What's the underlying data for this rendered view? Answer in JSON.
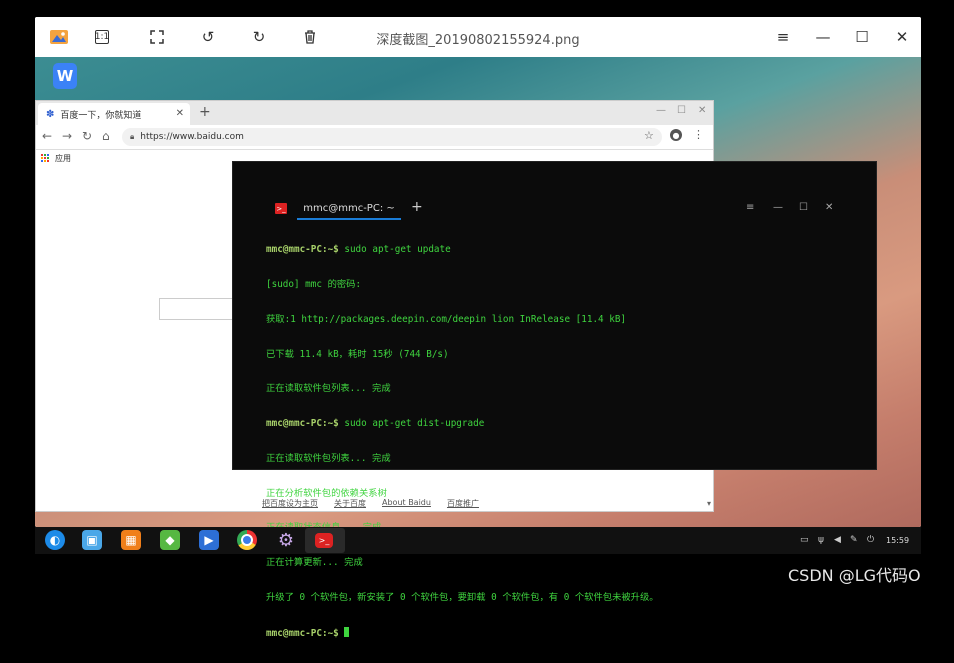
{
  "viewer": {
    "title": "深度截图_20190802155924.png",
    "toolbar": {
      "fit_label": "1:1"
    }
  },
  "browser": {
    "tab_title": "百度一下，你就知道",
    "url": "https://www.baidu.com",
    "bookmark_apps": "应用",
    "footer_links": [
      "把百度设为主页",
      "关于百度",
      "About Baidu",
      "百度推广"
    ]
  },
  "terminal": {
    "tab_title": "mmc@mmc-PC: ~",
    "lines": [
      {
        "prompt": "mmc@mmc-PC:~$",
        "text": " sudo apt-get update"
      },
      {
        "prompt": "",
        "text": "[sudo] mmc 的密码:"
      },
      {
        "prompt": "",
        "text": "获取:1 http://packages.deepin.com/deepin lion InRelease [11.4 kB]"
      },
      {
        "prompt": "",
        "text": "已下载 11.4 kB，耗时 15秒 (744 B/s)"
      },
      {
        "prompt": "",
        "text": "正在读取软件包列表... 完成"
      },
      {
        "prompt": "mmc@mmc-PC:~$",
        "text": " sudo apt-get dist-upgrade"
      },
      {
        "prompt": "",
        "text": "正在读取软件包列表... 完成"
      },
      {
        "prompt": "",
        "text": "正在分析软件包的依赖关系树"
      },
      {
        "prompt": "",
        "text": "正在读取状态信息... 完成"
      },
      {
        "prompt": "",
        "text": "正在计算更新... 完成"
      },
      {
        "prompt": "",
        "text": "升级了 0 个软件包，新安装了 0 个软件包，要卸载 0 个软件包，有 0 个软件包未被升级。"
      },
      {
        "prompt": "mmc@mmc-PC:~$",
        "text": " "
      }
    ]
  },
  "dock": {
    "clock": "15:59",
    "items": [
      "launcher-icon",
      "file-manager-icon",
      "app-store-icon",
      "deepin-store-icon",
      "video-player-icon",
      "chrome-icon",
      "settings-icon",
      "terminal-icon"
    ]
  },
  "watermark": "CSDN @LG代码O",
  "colors": {
    "terminal_text": "#3fd43f",
    "terminal_prompt": "#a8d26a",
    "tab_accent": "#1a7cd6"
  }
}
